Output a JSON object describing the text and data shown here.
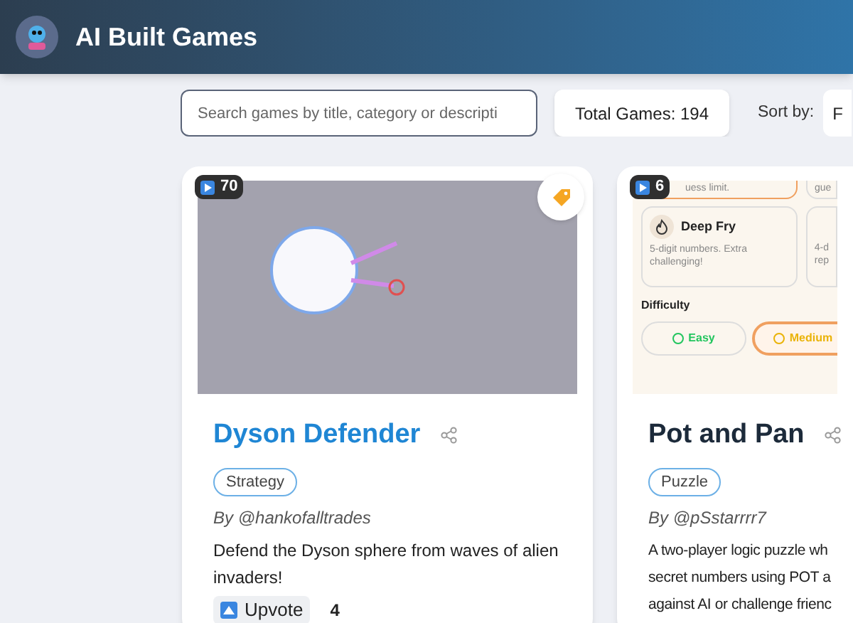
{
  "header": {
    "title": "AI Built Games"
  },
  "toolbar": {
    "search": {
      "placeholder": "Search games by title, category or descripti"
    },
    "total": "Total Games: 194",
    "sort_label": "Sort by:",
    "sort_value": "F"
  },
  "games": [
    {
      "plays": "70",
      "thumbnail": {
        "kind": "game"
      },
      "tagged": true,
      "title": "Dyson Defender",
      "category": "Strategy",
      "author": "By @hankofalltrades",
      "description": "Defend the Dyson sphere from waves of alien invaders!",
      "upvote": "Upvote",
      "votes": "4"
    },
    {
      "plays": "6",
      "thumbnail": {
        "kind": "app",
        "top_left": "uess limit.",
        "top_right": "gue",
        "mode": "Deep Fry",
        "mode_text": "5-digit numbers. Extra challenging!",
        "side_text": [
          "4-d",
          "rep"
        ],
        "difficulty_label": "Difficulty",
        "levels": [
          {
            "label": "Easy",
            "selected": false,
            "color": "#22c55e"
          },
          {
            "label": "Medium",
            "selected": true,
            "color": "#eab308"
          }
        ]
      },
      "tagged": false,
      "title": "Pot and Pan",
      "category": "Puzzle",
      "author": "By @pSstarrrr7",
      "description": [
        "A two-player logic puzzle wh",
        "secret numbers using POT a",
        "against AI or challenge frienc"
      ]
    }
  ]
}
